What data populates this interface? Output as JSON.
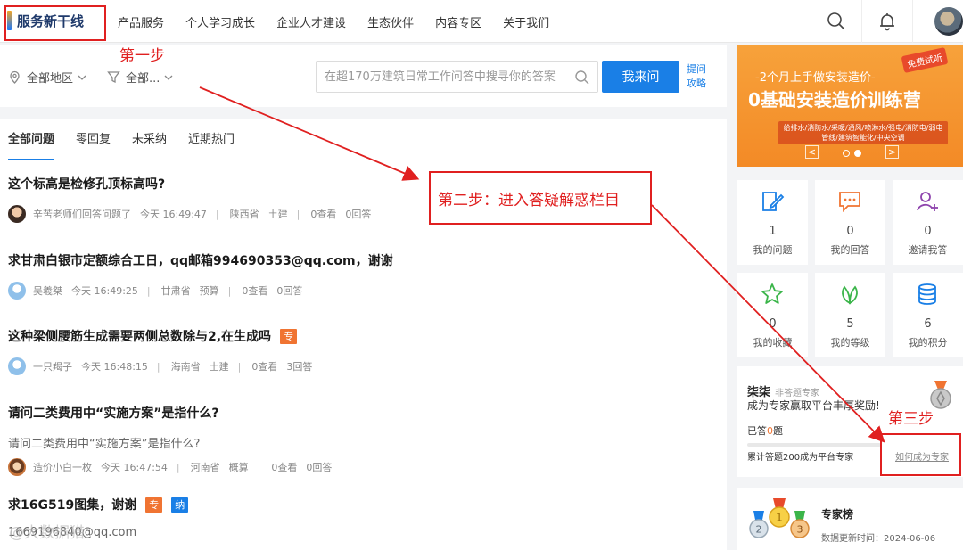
{
  "brand": {
    "name": "服务新干线"
  },
  "nav": {
    "items": [
      "产品服务",
      "个人学习成长",
      "企业人才建设",
      "生态伙伴",
      "内容专区",
      "关于我们"
    ]
  },
  "filters": {
    "region": "全部地区",
    "category": "全部..."
  },
  "search": {
    "placeholder": "在超170万建筑日常工作问答中搜寻你的答案",
    "ask_label": "我来问",
    "tip_link": "提问攻略"
  },
  "tabs": [
    "全部问题",
    "零回复",
    "未采纳",
    "近期热门"
  ],
  "questions": [
    {
      "title": "这个标高是检修孔顶标高吗?",
      "user": "辛苦老师们回答问题了",
      "time": "今天 16:49:47",
      "province": "陕西省",
      "category": "土建",
      "views": "0查看",
      "answers": "0回答"
    },
    {
      "title": "求甘肃白银市定额综合工日，qq邮箱994690353@qq.com，谢谢",
      "user": "吴羲桀",
      "time": "今天 16:49:25",
      "province": "甘肃省",
      "category": "预算",
      "views": "0查看",
      "answers": "0回答"
    },
    {
      "title": "这种梁侧腰筋生成需要两侧总数除与2,在生成吗",
      "badge": "专",
      "user": "一只羯子",
      "time": "今天 16:48:15",
      "province": "海南省",
      "category": "土建",
      "views": "0查看",
      "answers": "3回答"
    },
    {
      "title": "请问二类费用中“实施方案”是指什么?",
      "desc": "请问二类费用中“实施方案”是指什么?",
      "user": "造价小白一枚",
      "time": "今天 16:47:54",
      "province": "河南省",
      "category": "概算",
      "views": "0查看",
      "answers": "0回答"
    },
    {
      "title": "求16G519图集，谢谢",
      "badges": [
        "专",
        "纳"
      ],
      "desc": "1669196840@qq.com"
    }
  ],
  "banner": {
    "subtitle": "-2个月上手做安装造价-",
    "title": "0基础安装造价训练营",
    "tag": "免费试听",
    "keywords": "给排水/消防水/采暖/通风/喷淋水/强电/消防电/弱电管线/建筑智能化/中央空调",
    "prev": "<",
    "next": ">"
  },
  "stats": [
    {
      "icon": "edit-icon",
      "value": "1",
      "label": "我的问题"
    },
    {
      "icon": "chat-icon",
      "value": "0",
      "label": "我的回答"
    },
    {
      "icon": "invite-user-icon",
      "value": "0",
      "label": "邀请我答"
    },
    {
      "icon": "star-icon",
      "value": "0",
      "label": "我的收藏"
    },
    {
      "icon": "leaf-icon",
      "value": "5",
      "label": "我的等级"
    },
    {
      "icon": "coins-icon",
      "value": "6",
      "label": "我的积分"
    }
  ],
  "expert_card": {
    "name": "柒柒",
    "role": "非答题专家",
    "slogan": "成为专家赢取平台丰厚奖励!",
    "answered_prefix": "已答",
    "answered_count": "0",
    "answered_suffix": "题",
    "goal": "累计答题200成为平台专家",
    "link": "如何成为专家",
    "progress": 0
  },
  "rank": {
    "title": "专家榜",
    "date": "数据更新时间：2024-06-06"
  },
  "annotations": {
    "step1": "第一步",
    "step2": "第二步：进入答疑解惑栏目",
    "step3": "第三步"
  },
  "watermark": "@大数据猎",
  "colors": {
    "accent": "#1a7fe6",
    "annotation": "#e02020",
    "badge_orange": "#f07432",
    "banner": "#f38a26"
  }
}
